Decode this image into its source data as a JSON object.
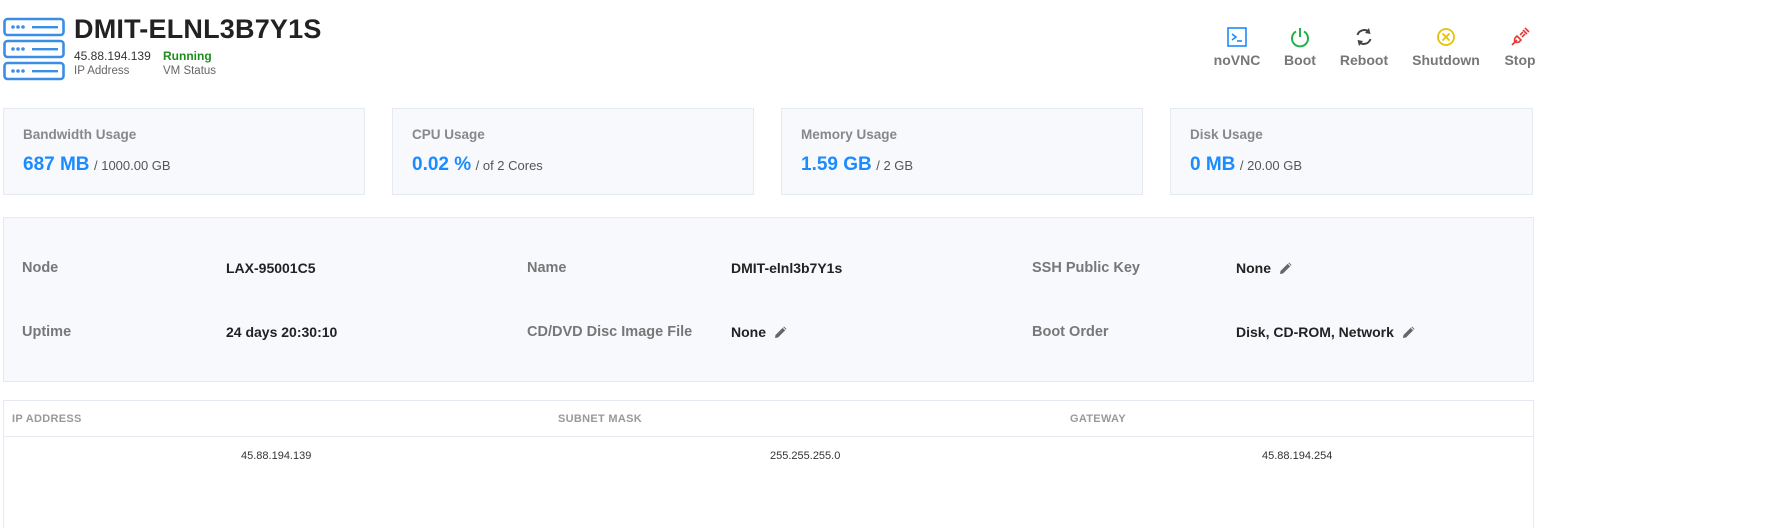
{
  "vm": {
    "title": "DMIT-ELNL3B7Y1S",
    "ip_value": "45.88.194.139",
    "ip_label": "IP Address",
    "status_value": "Running",
    "status_label": "VM Status"
  },
  "actions": [
    {
      "label": "noVNC",
      "icon": "terminal-icon",
      "color": "#1a8cff"
    },
    {
      "label": "Boot",
      "icon": "power-icon",
      "color": "#22b14c"
    },
    {
      "label": "Reboot",
      "icon": "refresh-icon",
      "color": "#444444"
    },
    {
      "label": "Shutdown",
      "icon": "cancel-circle-icon",
      "color": "#e6c300"
    },
    {
      "label": "Stop",
      "icon": "plug-icon",
      "color": "#e53935"
    }
  ],
  "usage": {
    "bandwidth": {
      "title": "Bandwidth Usage",
      "value": "687 MB",
      "total": "/ 1000.00 GB"
    },
    "cpu": {
      "title": "CPU Usage",
      "value": "0.02 %",
      "total": "/ of 2 Cores"
    },
    "memory": {
      "title": "Memory Usage",
      "value": "1.59 GB",
      "total": "/ 2 GB"
    },
    "disk": {
      "title": "Disk Usage",
      "value": "0 MB",
      "total": "/ 20.00 GB"
    }
  },
  "details": {
    "node_label": "Node",
    "node_value": "LAX-95001C5",
    "name_label": "Name",
    "name_value": "DMIT-elnl3b7Y1s",
    "ssh_label": "SSH Public Key",
    "ssh_value": "None",
    "uptime_label": "Uptime",
    "uptime_value": "24 days 20:30:10",
    "iso_label": "CD/DVD Disc Image File",
    "iso_value": "None",
    "boot_label": "Boot Order",
    "boot_value": "Disk, CD-ROM, Network"
  },
  "ip_table": {
    "headers": [
      "IP ADDRESS",
      "SUBNET MASK",
      "GATEWAY"
    ],
    "rows": [
      [
        "45.88.194.139",
        "255.255.255.0",
        "45.88.194.254"
      ]
    ]
  },
  "colors": {
    "accent": "#1a8cff",
    "running": "#1e8e1e"
  }
}
